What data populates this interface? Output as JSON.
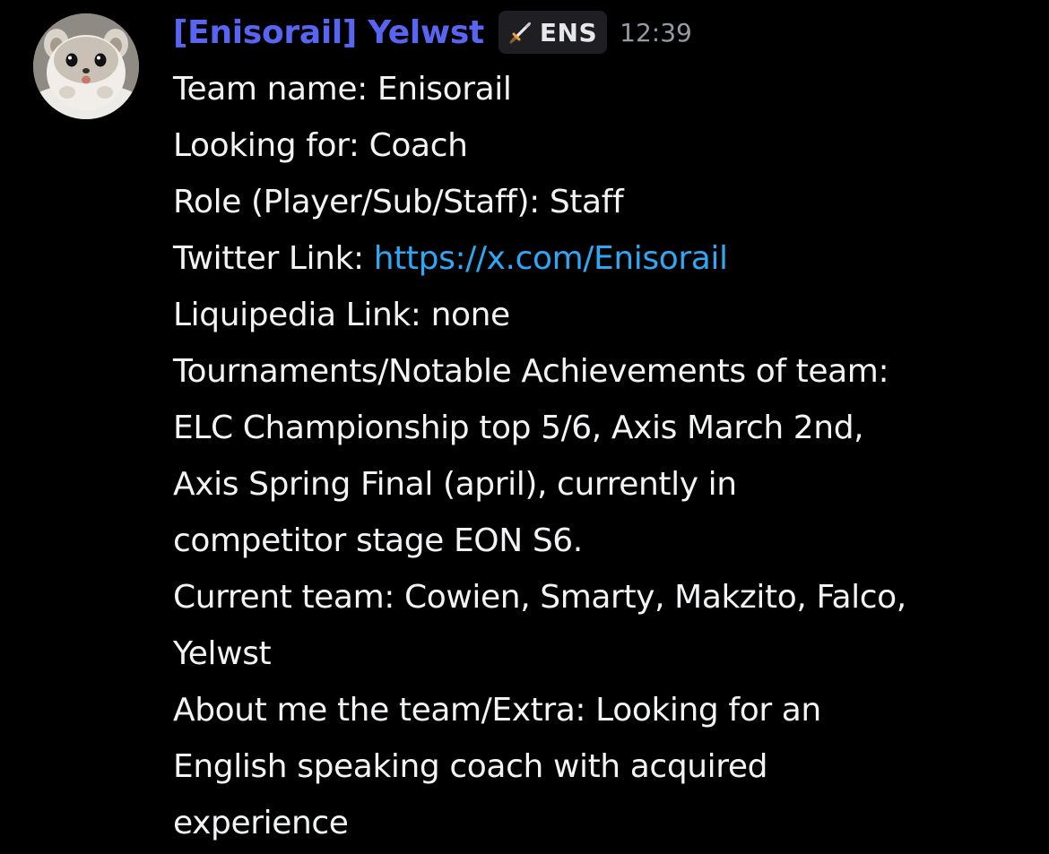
{
  "message": {
    "author": "[Enisorail] Yelwst",
    "tag": {
      "icon": "sword-icon",
      "label": "ENS"
    },
    "timestamp": "12:39",
    "lines": [
      {
        "text": "Team name: Enisorail"
      },
      {
        "text": "Looking for: Coach"
      },
      {
        "text": "Role (Player/Sub/Staff): Staff"
      },
      {
        "prefix": "Twitter Link: ",
        "link": "https://x.com/Enisorail"
      },
      {
        "text": "Liquipedia Link: none"
      },
      {
        "text": "Tournaments/Notable Achievements of team:"
      },
      {
        "text": "ELC Championship top 5/6, Axis March 2nd,"
      },
      {
        "text": "Axis Spring Final (april), currently in"
      },
      {
        "text": "competitor stage EON S6."
      },
      {
        "text": "Current team: Cowien, Smarty, Makzito, Falco,"
      },
      {
        "text": "Yelwst"
      },
      {
        "text": "About me the team/Extra: Looking for an"
      },
      {
        "text": "English speaking coach with acquired"
      },
      {
        "text": "experience"
      }
    ]
  },
  "colors": {
    "background": "#000000",
    "username": "#5865f2",
    "link": "#2ea8f5",
    "timestamp": "#949ba4",
    "text": "#f2f3f5"
  }
}
